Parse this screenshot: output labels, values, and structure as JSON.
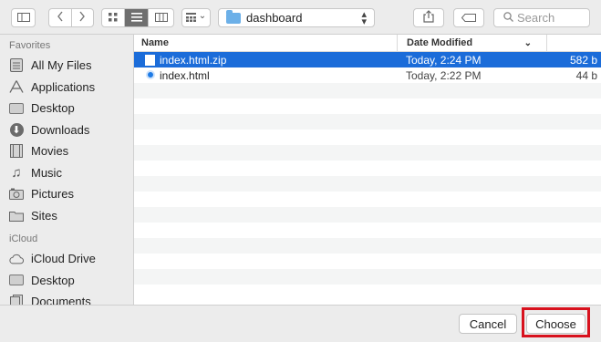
{
  "toolbar": {
    "sidebar_toggle_icon": "sidebar-icon",
    "back_icon": "chevron-left-icon",
    "forward_icon": "chevron-right-icon",
    "view_icons": [
      "icon-view-icon",
      "list-view-icon",
      "column-view-icon"
    ],
    "arrange_icon": "arrange-grid-icon",
    "arrange_chevron": "⌄",
    "path_folder": "dashboard",
    "share_icon": "share-icon",
    "tag_icon": "tag-icon",
    "search_placeholder": "Search",
    "search_icon": "magnifier-icon"
  },
  "sidebar": {
    "favorites_heading": "Favorites",
    "favorites": [
      {
        "label": "All My Files",
        "icon": "all-files-icon"
      },
      {
        "label": "Applications",
        "icon": "applications-icon"
      },
      {
        "label": "Desktop",
        "icon": "desktop-icon"
      },
      {
        "label": "Downloads",
        "icon": "downloads-icon"
      },
      {
        "label": "Movies",
        "icon": "movies-icon"
      },
      {
        "label": "Music",
        "icon": "music-icon"
      },
      {
        "label": "Pictures",
        "icon": "pictures-icon"
      },
      {
        "label": "Sites",
        "icon": "folder-icon"
      }
    ],
    "icloud_heading": "iCloud",
    "icloud": [
      {
        "label": "iCloud Drive",
        "icon": "cloud-icon"
      },
      {
        "label": "Desktop",
        "icon": "desktop-icon"
      },
      {
        "label": "Documents",
        "icon": "documents-icon"
      }
    ]
  },
  "list": {
    "headers": {
      "name": "Name",
      "date": "Date Modified",
      "sort_chevron": "⌄"
    },
    "rows": [
      {
        "name": "index.html.zip",
        "date": "Today, 2:24 PM",
        "size": "582 b",
        "selected": true
      },
      {
        "name": "index.html",
        "date": "Today, 2:22 PM",
        "size": "44 b",
        "selected": false
      }
    ]
  },
  "footer": {
    "cancel_label": "Cancel",
    "choose_label": "Choose"
  },
  "colors": {
    "selection": "#1b6cd9",
    "highlight_border": "#d8121e"
  }
}
